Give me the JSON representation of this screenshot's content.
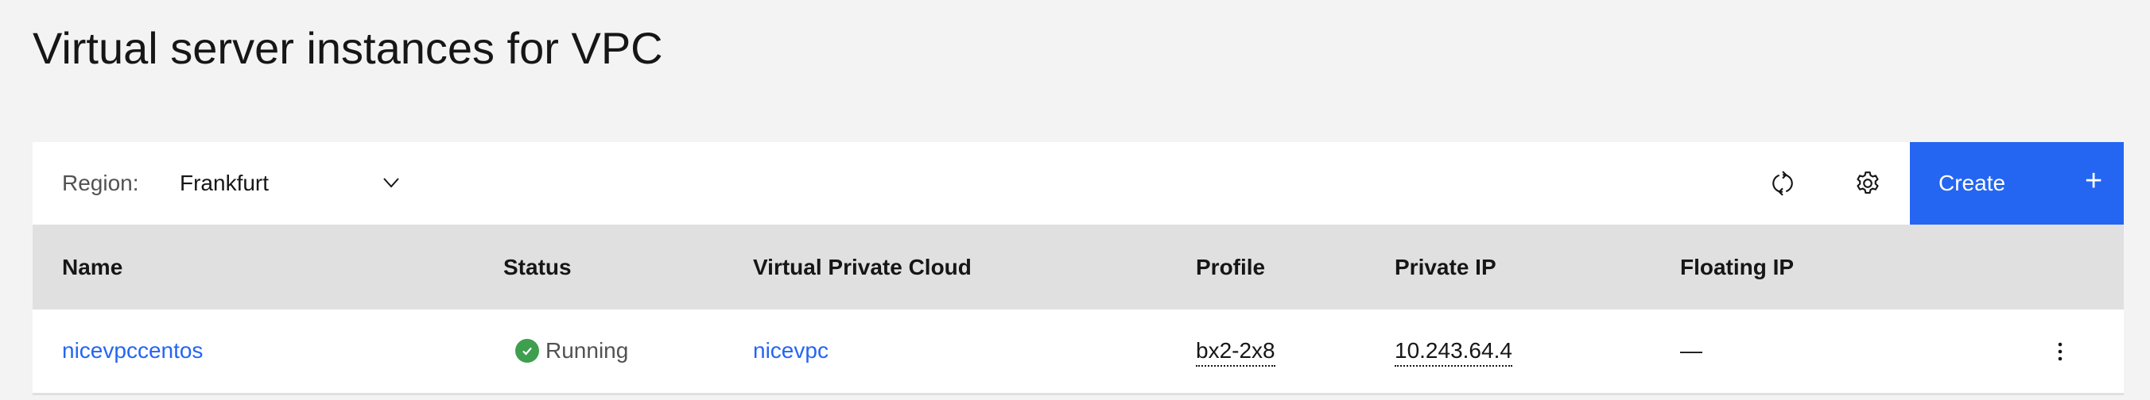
{
  "page": {
    "title": "Virtual server instances for VPC"
  },
  "toolbar": {
    "region_label": "Region:",
    "region_value": "Frankfurt",
    "refresh_icon": "refresh-icon",
    "settings_icon": "gear-icon",
    "create_label": "Create",
    "create_icon": "+"
  },
  "colors": {
    "accent": "#2466f2",
    "status_running": "#3e9f4f",
    "header_bg": "#e0e0e0"
  },
  "table": {
    "columns": [
      "Name",
      "Status",
      "Virtual Private Cloud",
      "Profile",
      "Private IP",
      "Floating IP"
    ],
    "rows": [
      {
        "name": "nicevpccentos",
        "status": "Running",
        "vpc": "nicevpc",
        "profile": "bx2-2x8",
        "private_ip": "10.243.64.4",
        "floating_ip": "—"
      }
    ]
  }
}
